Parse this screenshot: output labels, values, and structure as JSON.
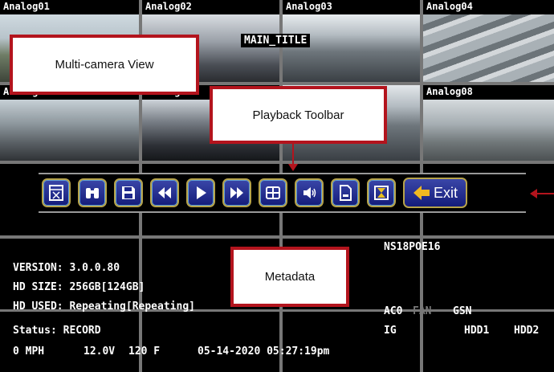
{
  "cameras": [
    {
      "label": "Analog01"
    },
    {
      "label": "Analog02"
    },
    {
      "label": "Analog03"
    },
    {
      "label": "Analog04"
    },
    {
      "label": "Analog05"
    },
    {
      "label": "Analog06"
    },
    {
      "label": ""
    },
    {
      "label": "Analog08"
    }
  ],
  "overlay": {
    "main_title": "MAIN_TITLE"
  },
  "callouts": {
    "multi_camera": "Multi-camera View",
    "playback_toolbar": "Playback Toolbar",
    "metadata": "Metadata"
  },
  "toolbar": {
    "buttons": [
      {
        "icon": "clip-icon"
      },
      {
        "icon": "search-binoculars-icon"
      },
      {
        "icon": "save-icon"
      },
      {
        "icon": "rewind-icon"
      },
      {
        "icon": "play-icon"
      },
      {
        "icon": "fast-forward-icon"
      },
      {
        "icon": "split-view-icon"
      },
      {
        "icon": "volume-icon"
      },
      {
        "icon": "document-icon"
      },
      {
        "icon": "zoom-icon"
      }
    ],
    "exit_label": "Exit"
  },
  "metadata": {
    "device_name": "NS18POE16",
    "version": "VERSION: 3.0.0.80",
    "hd_size": "HD SIZE: 256GB[124GB]",
    "hd_used": "HD USED: Repeating[Repeating]",
    "status": "Status: RECORD",
    "speed": "0 MPH",
    "voltage": "12.0V",
    "temperature": "120 F",
    "datetime": "05-14-2020 05:27:19pm",
    "ac0": "AC0",
    "fan": "FAN",
    "gsn": "GSN",
    "ig": "IG",
    "hdd1": "HDD1",
    "hdd2": "HDD2"
  },
  "colors": {
    "callout_border": "#b3141d",
    "button_fill": "#1e288c",
    "selected_outline": "#2a56c8"
  }
}
